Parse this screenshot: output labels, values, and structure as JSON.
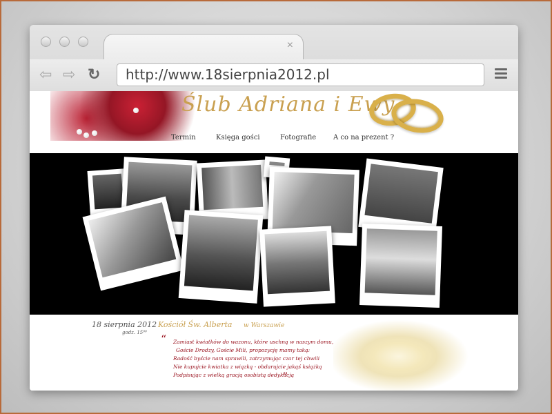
{
  "browser": {
    "tab": {
      "close_glyph": "×"
    },
    "toolbar": {
      "back_glyph": "⇦",
      "forward_glyph": "⇨",
      "reload_glyph": "↻",
      "url": "http://www.18sierpnia2012.pl"
    }
  },
  "site": {
    "title": "Ślub Adriana i Ewy",
    "nav": [
      "Termin",
      "Księga gości",
      "Fotografie",
      "A co na prezent ?"
    ],
    "event": {
      "date": "18 sierpnia 2012",
      "time": "godz. 15⁰⁰",
      "church": "Kościół Św. Alberta",
      "city": "w Warszawie"
    },
    "poem": [
      "Zamiast kwiatków do wazonu, które uschną w naszym domu,",
      "Goście Drodzy, Goście Mili, propozycję mamy taką:",
      "Radość byście nam sprawili, zatrzymując czar tej chwili",
      "Nie kupujcie kwiatka z wiązką - obdarujcie jakąś książką",
      "Podpisując z wielką gracją osobistą dedykacją"
    ],
    "quote_open": "“",
    "quote_close": "”"
  },
  "colors": {
    "title_gold": "#c9a050",
    "poem_red": "#9a1420",
    "banner_bg": "#000000"
  }
}
